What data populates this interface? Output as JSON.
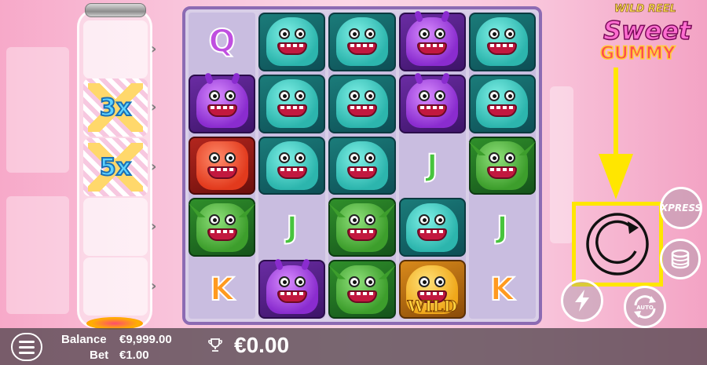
{
  "game": {
    "logo": {
      "line1": "WILD REEL",
      "line2": "Sweet",
      "line3": "GUMMY"
    }
  },
  "multipliers": [
    {
      "label": ""
    },
    {
      "label": "3x"
    },
    {
      "label": "5x"
    },
    {
      "label": ""
    },
    {
      "label": ""
    }
  ],
  "reels": [
    [
      "letter-Q",
      "monster-purple",
      "monster-red",
      "monster-green",
      "letter-K"
    ],
    [
      "monster-teal",
      "monster-teal",
      "monster-teal",
      "letter-J",
      "monster-purple"
    ],
    [
      "monster-teal",
      "monster-teal",
      "monster-teal",
      "monster-green",
      "monster-green"
    ],
    [
      "monster-purple",
      "monster-purple",
      "letter-J",
      "monster-teal",
      "wild"
    ],
    [
      "monster-teal",
      "monster-teal",
      "monster-green",
      "letter-J",
      "letter-K"
    ]
  ],
  "symbols": {
    "Q": "Q",
    "K": "K",
    "J": "J",
    "wild": "WILD"
  },
  "controls": {
    "xpress_label": "XPRESS",
    "auto_label": "AUTO"
  },
  "status": {
    "balance_label": "Balance",
    "balance_value": "€9,999.00",
    "bet_label": "Bet",
    "bet_value": "€1.00",
    "win_value": "€0.00"
  },
  "colors": {
    "annotation": "#ffe600",
    "frame": "#8c6bb3"
  }
}
